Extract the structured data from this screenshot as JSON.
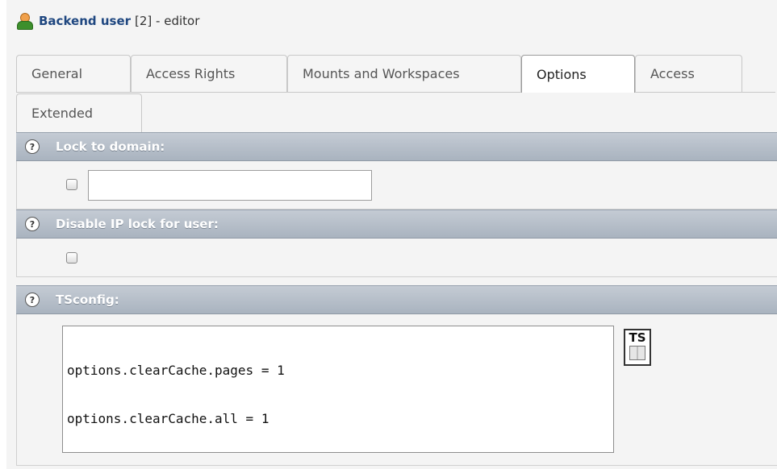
{
  "header": {
    "title_bold": "Backend user",
    "title_rest": "[2] - editor",
    "icon": "user-icon"
  },
  "tabs": [
    {
      "label": "General",
      "active": false
    },
    {
      "label": "Access Rights",
      "active": false
    },
    {
      "label": "Mounts and Workspaces",
      "active": false
    },
    {
      "label": "Options",
      "active": true
    },
    {
      "label": "Access",
      "active": false
    },
    {
      "label": "Extended",
      "active": false
    }
  ],
  "sections": {
    "lock_domain": {
      "title": "Lock to domain:",
      "checked": false,
      "value": ""
    },
    "disable_ip_lock": {
      "title": "Disable IP lock for user:",
      "checked": false
    },
    "tsconfig": {
      "title": "TSconfig:",
      "lines": [
        "options.clearCache.pages = 1",
        "options.clearCache.all = 1"
      ],
      "ts_button_label": "TS"
    }
  },
  "help_icon_glyph": "?"
}
